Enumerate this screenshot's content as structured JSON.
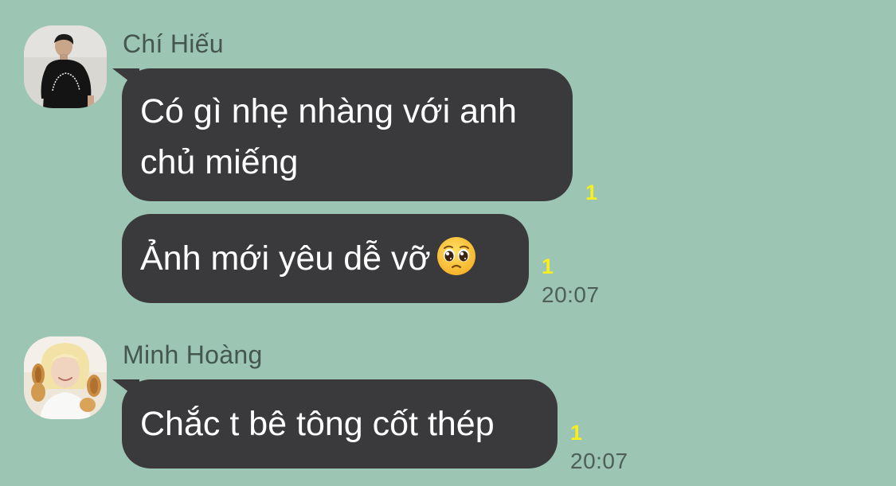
{
  "colors": {
    "background": "#9CC5B4",
    "bubble": "#3A3A3C",
    "bubble_text": "#FFFFFF",
    "sender_name": "#44574F",
    "read_count": "#F7EE22",
    "timestamp": "#4D5F57"
  },
  "messages": [
    {
      "sender": "Chí Hiếu",
      "avatar": "avatar-photo-man-black-tshirt",
      "bubbles": [
        {
          "lines": [
            "Có gì nhẹ nhàng với anh",
            "chủ miếng"
          ],
          "read_count": "1",
          "time": ""
        },
        {
          "lines": [
            "Ảnh mới yêu dễ vỡ"
          ],
          "emoji": "pleading-face-emoji",
          "read_count": "1",
          "time": "20:07"
        }
      ]
    },
    {
      "sender": "Minh Hoàng",
      "avatar": "avatar-photo-blonde-person-holding-pastry",
      "bubbles": [
        {
          "lines": [
            "Chắc t bê tông cốt thép"
          ],
          "read_count": "1",
          "time": "20:07"
        }
      ]
    }
  ]
}
